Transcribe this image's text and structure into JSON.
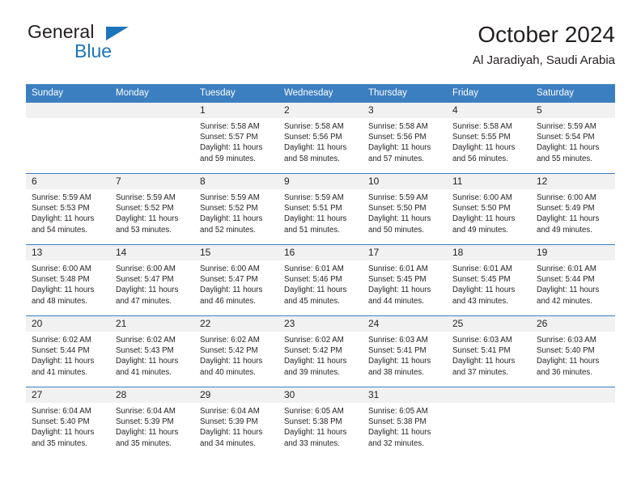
{
  "brand": {
    "name_top": "General",
    "name_bottom": "Blue",
    "triangle_color": "#1b75bb"
  },
  "header": {
    "title": "October 2024",
    "subtitle": "Al Jaradiyah, Saudi Arabia"
  },
  "colors": {
    "header_blue": "#3c7fc1",
    "daynum_band": "#f1f1f1",
    "text": "#231f20",
    "brand_blue": "#1b75bb"
  },
  "weekdays": [
    "Sunday",
    "Monday",
    "Tuesday",
    "Wednesday",
    "Thursday",
    "Friday",
    "Saturday"
  ],
  "weeks": [
    [
      {
        "day": "",
        "sunrise": "",
        "sunset": "",
        "daylight1": "",
        "daylight2": ""
      },
      {
        "day": "",
        "sunrise": "",
        "sunset": "",
        "daylight1": "",
        "daylight2": ""
      },
      {
        "day": "1",
        "sunrise": "Sunrise: 5:58 AM",
        "sunset": "Sunset: 5:57 PM",
        "daylight1": "Daylight: 11 hours",
        "daylight2": "and 59 minutes."
      },
      {
        "day": "2",
        "sunrise": "Sunrise: 5:58 AM",
        "sunset": "Sunset: 5:56 PM",
        "daylight1": "Daylight: 11 hours",
        "daylight2": "and 58 minutes."
      },
      {
        "day": "3",
        "sunrise": "Sunrise: 5:58 AM",
        "sunset": "Sunset: 5:56 PM",
        "daylight1": "Daylight: 11 hours",
        "daylight2": "and 57 minutes."
      },
      {
        "day": "4",
        "sunrise": "Sunrise: 5:58 AM",
        "sunset": "Sunset: 5:55 PM",
        "daylight1": "Daylight: 11 hours",
        "daylight2": "and 56 minutes."
      },
      {
        "day": "5",
        "sunrise": "Sunrise: 5:59 AM",
        "sunset": "Sunset: 5:54 PM",
        "daylight1": "Daylight: 11 hours",
        "daylight2": "and 55 minutes."
      }
    ],
    [
      {
        "day": "6",
        "sunrise": "Sunrise: 5:59 AM",
        "sunset": "Sunset: 5:53 PM",
        "daylight1": "Daylight: 11 hours",
        "daylight2": "and 54 minutes."
      },
      {
        "day": "7",
        "sunrise": "Sunrise: 5:59 AM",
        "sunset": "Sunset: 5:52 PM",
        "daylight1": "Daylight: 11 hours",
        "daylight2": "and 53 minutes."
      },
      {
        "day": "8",
        "sunrise": "Sunrise: 5:59 AM",
        "sunset": "Sunset: 5:52 PM",
        "daylight1": "Daylight: 11 hours",
        "daylight2": "and 52 minutes."
      },
      {
        "day": "9",
        "sunrise": "Sunrise: 5:59 AM",
        "sunset": "Sunset: 5:51 PM",
        "daylight1": "Daylight: 11 hours",
        "daylight2": "and 51 minutes."
      },
      {
        "day": "10",
        "sunrise": "Sunrise: 5:59 AM",
        "sunset": "Sunset: 5:50 PM",
        "daylight1": "Daylight: 11 hours",
        "daylight2": "and 50 minutes."
      },
      {
        "day": "11",
        "sunrise": "Sunrise: 6:00 AM",
        "sunset": "Sunset: 5:50 PM",
        "daylight1": "Daylight: 11 hours",
        "daylight2": "and 49 minutes."
      },
      {
        "day": "12",
        "sunrise": "Sunrise: 6:00 AM",
        "sunset": "Sunset: 5:49 PM",
        "daylight1": "Daylight: 11 hours",
        "daylight2": "and 49 minutes."
      }
    ],
    [
      {
        "day": "13",
        "sunrise": "Sunrise: 6:00 AM",
        "sunset": "Sunset: 5:48 PM",
        "daylight1": "Daylight: 11 hours",
        "daylight2": "and 48 minutes."
      },
      {
        "day": "14",
        "sunrise": "Sunrise: 6:00 AM",
        "sunset": "Sunset: 5:47 PM",
        "daylight1": "Daylight: 11 hours",
        "daylight2": "and 47 minutes."
      },
      {
        "day": "15",
        "sunrise": "Sunrise: 6:00 AM",
        "sunset": "Sunset: 5:47 PM",
        "daylight1": "Daylight: 11 hours",
        "daylight2": "and 46 minutes."
      },
      {
        "day": "16",
        "sunrise": "Sunrise: 6:01 AM",
        "sunset": "Sunset: 5:46 PM",
        "daylight1": "Daylight: 11 hours",
        "daylight2": "and 45 minutes."
      },
      {
        "day": "17",
        "sunrise": "Sunrise: 6:01 AM",
        "sunset": "Sunset: 5:45 PM",
        "daylight1": "Daylight: 11 hours",
        "daylight2": "and 44 minutes."
      },
      {
        "day": "18",
        "sunrise": "Sunrise: 6:01 AM",
        "sunset": "Sunset: 5:45 PM",
        "daylight1": "Daylight: 11 hours",
        "daylight2": "and 43 minutes."
      },
      {
        "day": "19",
        "sunrise": "Sunrise: 6:01 AM",
        "sunset": "Sunset: 5:44 PM",
        "daylight1": "Daylight: 11 hours",
        "daylight2": "and 42 minutes."
      }
    ],
    [
      {
        "day": "20",
        "sunrise": "Sunrise: 6:02 AM",
        "sunset": "Sunset: 5:44 PM",
        "daylight1": "Daylight: 11 hours",
        "daylight2": "and 41 minutes."
      },
      {
        "day": "21",
        "sunrise": "Sunrise: 6:02 AM",
        "sunset": "Sunset: 5:43 PM",
        "daylight1": "Daylight: 11 hours",
        "daylight2": "and 41 minutes."
      },
      {
        "day": "22",
        "sunrise": "Sunrise: 6:02 AM",
        "sunset": "Sunset: 5:42 PM",
        "daylight1": "Daylight: 11 hours",
        "daylight2": "and 40 minutes."
      },
      {
        "day": "23",
        "sunrise": "Sunrise: 6:02 AM",
        "sunset": "Sunset: 5:42 PM",
        "daylight1": "Daylight: 11 hours",
        "daylight2": "and 39 minutes."
      },
      {
        "day": "24",
        "sunrise": "Sunrise: 6:03 AM",
        "sunset": "Sunset: 5:41 PM",
        "daylight1": "Daylight: 11 hours",
        "daylight2": "and 38 minutes."
      },
      {
        "day": "25",
        "sunrise": "Sunrise: 6:03 AM",
        "sunset": "Sunset: 5:41 PM",
        "daylight1": "Daylight: 11 hours",
        "daylight2": "and 37 minutes."
      },
      {
        "day": "26",
        "sunrise": "Sunrise: 6:03 AM",
        "sunset": "Sunset: 5:40 PM",
        "daylight1": "Daylight: 11 hours",
        "daylight2": "and 36 minutes."
      }
    ],
    [
      {
        "day": "27",
        "sunrise": "Sunrise: 6:04 AM",
        "sunset": "Sunset: 5:40 PM",
        "daylight1": "Daylight: 11 hours",
        "daylight2": "and 35 minutes."
      },
      {
        "day": "28",
        "sunrise": "Sunrise: 6:04 AM",
        "sunset": "Sunset: 5:39 PM",
        "daylight1": "Daylight: 11 hours",
        "daylight2": "and 35 minutes."
      },
      {
        "day": "29",
        "sunrise": "Sunrise: 6:04 AM",
        "sunset": "Sunset: 5:39 PM",
        "daylight1": "Daylight: 11 hours",
        "daylight2": "and 34 minutes."
      },
      {
        "day": "30",
        "sunrise": "Sunrise: 6:05 AM",
        "sunset": "Sunset: 5:38 PM",
        "daylight1": "Daylight: 11 hours",
        "daylight2": "and 33 minutes."
      },
      {
        "day": "31",
        "sunrise": "Sunrise: 6:05 AM",
        "sunset": "Sunset: 5:38 PM",
        "daylight1": "Daylight: 11 hours",
        "daylight2": "and 32 minutes."
      },
      {
        "day": "",
        "sunrise": "",
        "sunset": "",
        "daylight1": "",
        "daylight2": ""
      },
      {
        "day": "",
        "sunrise": "",
        "sunset": "",
        "daylight1": "",
        "daylight2": ""
      }
    ]
  ]
}
